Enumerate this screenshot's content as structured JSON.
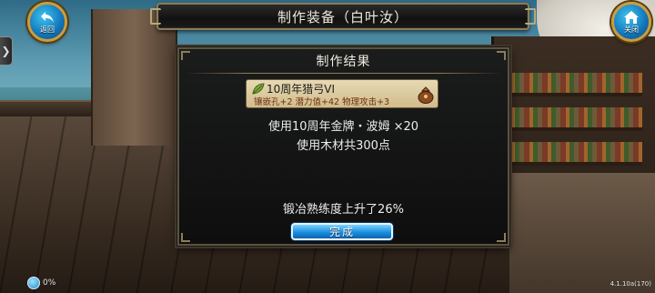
{
  "header": {
    "title": "制作装备（白叶汝）",
    "back_label": "返回",
    "close_label": "关闭",
    "side_tab_glyph": "❯"
  },
  "dialog": {
    "title": "制作结果",
    "item": {
      "name": "10周年猎弓VI",
      "stats": "镶嵌孔+2 潜力值+42 物理攻击+3",
      "icon": "leaf-icon",
      "bag_icon": "bag-icon"
    },
    "material_line": "使用10周年金牌・波姆 ×20",
    "wood_line": "使用木材共300点",
    "proficiency_line": "锻冶熟练度上升了26%",
    "confirm_label": "完成"
  },
  "status": {
    "percent": "0%",
    "version": "4.1.10a(170)"
  },
  "colors": {
    "button_blue": "#1b8fe0",
    "gold_frame": "#c89d3f",
    "stat_text": "#6d2f12"
  }
}
